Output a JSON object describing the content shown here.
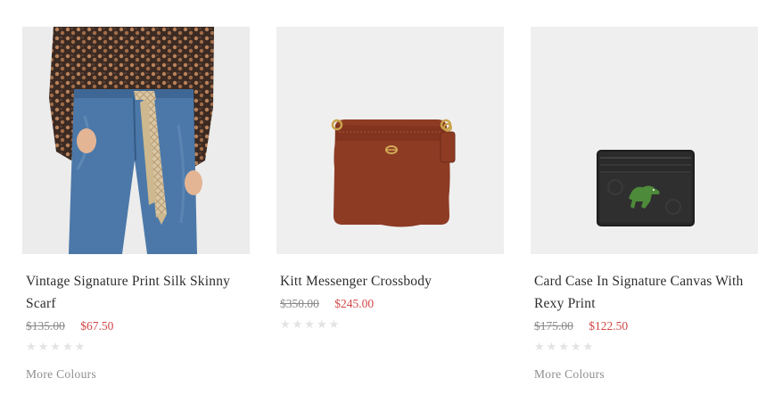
{
  "products": [
    {
      "title": "Vintage Signature Print Silk Skinny Scarf",
      "original_price": "$135.00",
      "sale_price": "$67.50",
      "rating_stars": "★★★★★",
      "rating_value": 0,
      "more_colours": "More Colours"
    },
    {
      "title": "Kitt Messenger Crossbody",
      "original_price": "$350.00",
      "sale_price": "$245.00",
      "rating_stars": "★★★★★",
      "rating_value": 0
    },
    {
      "title": "Card Case In Signature Canvas With Rexy Print",
      "original_price": "$175.00",
      "sale_price": "$122.50",
      "rating_stars": "★★★★★",
      "rating_value": 0,
      "more_colours": "More Colours"
    }
  ],
  "colors": {
    "image_bg": "#efefef",
    "sale_price": "#d24747",
    "original_price": "#8a8a8a",
    "star_empty": "#e3e3e3",
    "more_colours": "#8e8e8e"
  }
}
